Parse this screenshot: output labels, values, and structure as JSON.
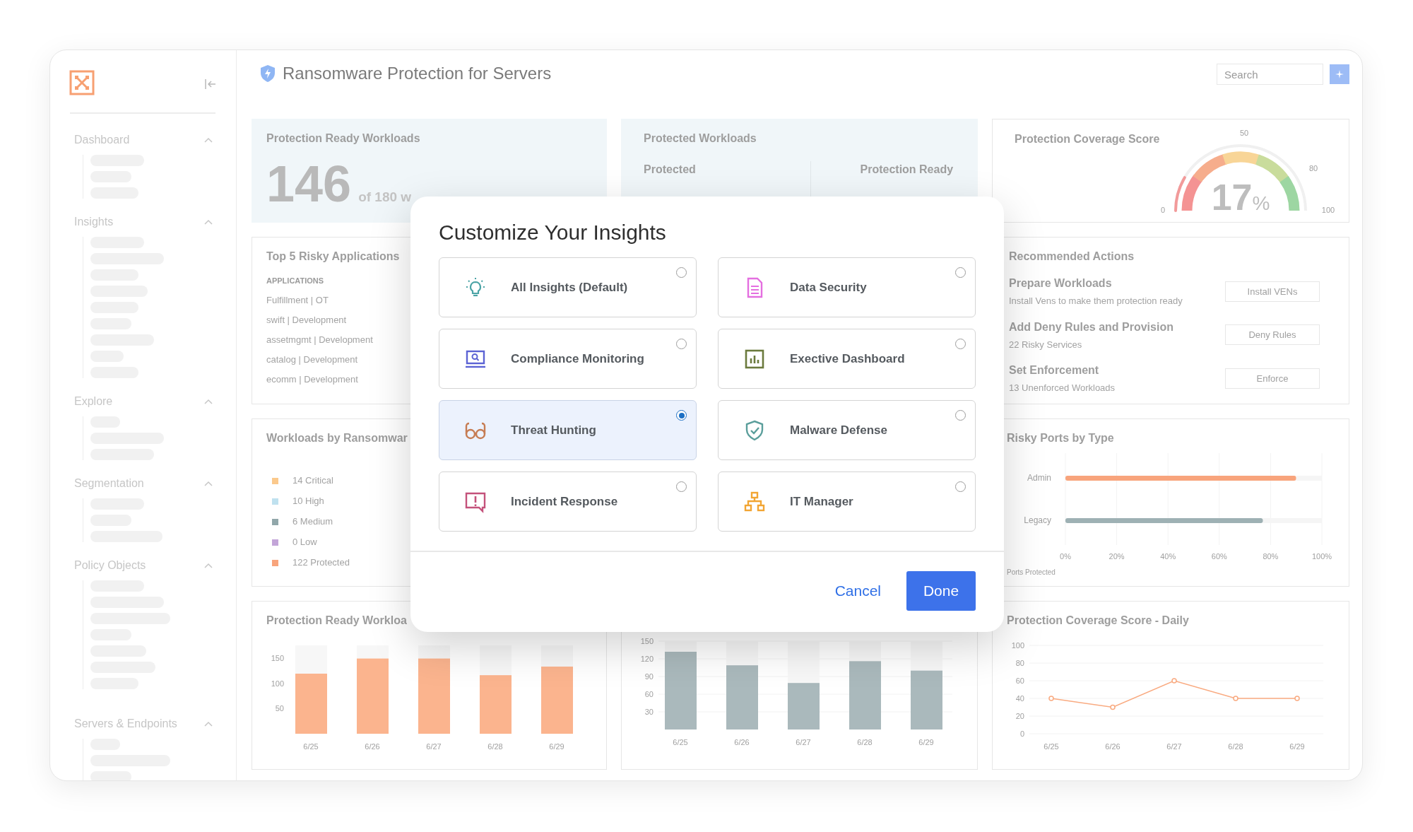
{
  "sidebar": {
    "sections": [
      {
        "label": "Dashboard",
        "expanded": true
      },
      {
        "label": "Insights",
        "expanded": true
      },
      {
        "label": "Explore",
        "expanded": true
      },
      {
        "label": "Segmentation",
        "expanded": true
      },
      {
        "label": "Policy Objects",
        "expanded": true
      },
      {
        "label": "Servers & Endpoints",
        "expanded": true
      }
    ]
  },
  "header": {
    "title": "Ransomware Protection for Servers",
    "search": {
      "placeholder": "Search"
    }
  },
  "protection_ready_card": {
    "title": "Protection Ready Workloads",
    "value": "146",
    "suffix": "of 180 w"
  },
  "protected_card": {
    "title": "Protected Workloads",
    "stats": [
      {
        "label": "Protected"
      },
      {
        "label": "Protection Ready"
      }
    ]
  },
  "coverage_card": {
    "title": "Protection Coverage Score",
    "reading": "17",
    "unit": "%",
    "ticks": [
      "0",
      "50",
      "80",
      "100"
    ]
  },
  "risky_apps": {
    "title": "Top 5 Risky Applications",
    "column": "APPLICATIONS",
    "rows": [
      "Fulfillment | OT",
      "swift | Development",
      "assetmgmt | Development",
      "catalog | Development",
      "ecomm | Development"
    ]
  },
  "recommended": {
    "title": "Recommended Actions",
    "actions": [
      {
        "title": "Prepare Workloads",
        "subtitle": "Install Vens to make them protection ready",
        "button": "Install VENs"
      },
      {
        "title": "Add Deny Rules and Provision",
        "subtitle": "22 Risky Services",
        "button": "Deny Rules"
      },
      {
        "title": "Set Enforcement",
        "subtitle": "13 Unenforced Workloads",
        "button": "Enforce"
      }
    ]
  },
  "workloads_by_ransomware": {
    "title": "Workloads by Ransomwar",
    "legend": [
      {
        "label": "14 Critical",
        "color": "#fbc98c"
      },
      {
        "label": "10 High",
        "color": "#bfe1ef"
      },
      {
        "label": "6 Medium",
        "color": "#91a7aa"
      },
      {
        "label": "0 Low",
        "color": "#c3a5d8"
      },
      {
        "label": "122 Protected",
        "color": "#f8a47c"
      }
    ]
  },
  "risky_ports": {
    "title": "Risky Ports by Type",
    "chart_data": {
      "type": "bar",
      "orientation": "horizontal",
      "categories": [
        "Admin",
        "Legacy"
      ],
      "values": [
        90,
        77
      ],
      "xlabel": "Ports Protected",
      "xlim": [
        0,
        100
      ],
      "grid": true,
      "xticks": [
        {
          "value": 0,
          "label": "0%"
        },
        {
          "value": 20,
          "label": "20%"
        },
        {
          "value": 40,
          "label": "40%"
        },
        {
          "value": 60,
          "label": "60%"
        },
        {
          "value": 80,
          "label": "80%"
        },
        {
          "value": 100,
          "label": "100%"
        }
      ]
    }
  },
  "ready_chart": {
    "title": "Protection Ready Workloa",
    "chart_data": {
      "type": "bar",
      "categories": [
        "6/25",
        "6/26",
        "6/27",
        "6/28",
        "6/29"
      ],
      "values": [
        119,
        149,
        149,
        116,
        133
      ],
      "ylim": [
        0,
        175
      ],
      "yticks": [
        50,
        100,
        150
      ]
    }
  },
  "middle_chart": {
    "chart_data": {
      "type": "bar",
      "categories": [
        "6/25",
        "6/26",
        "6/27",
        "6/28",
        "6/29"
      ],
      "values": [
        132,
        109,
        79,
        116,
        100
      ],
      "ylim": [
        0,
        150
      ],
      "grid": true,
      "yticks": [
        30,
        60,
        90,
        120,
        150
      ]
    }
  },
  "daily_chart": {
    "title": "Protection Coverage Score - Daily",
    "chart_data": {
      "type": "line",
      "categories": [
        "6/25",
        "6/26",
        "6/27",
        "6/28",
        "6/29"
      ],
      "values": [
        40,
        30,
        60,
        40,
        40
      ],
      "ylim": [
        0,
        100
      ],
      "grid": true,
      "marker": true,
      "yticks": [
        0,
        20,
        40,
        60,
        80,
        100
      ]
    }
  },
  "modal": {
    "title": "Customize Your Insights",
    "options": [
      {
        "label": "All Insights (Default)",
        "selected": false
      },
      {
        "label": "Data Security",
        "selected": false
      },
      {
        "label": "Compliance Monitoring",
        "selected": false
      },
      {
        "label": "Exective Dashboard",
        "selected": false
      },
      {
        "label": "Threat Hunting",
        "selected": true
      },
      {
        "label": "Malware Defense",
        "selected": false
      },
      {
        "label": "Incident Response",
        "selected": false
      },
      {
        "label": "IT Manager",
        "selected": false
      }
    ],
    "cancel": "Cancel",
    "done": "Done"
  }
}
